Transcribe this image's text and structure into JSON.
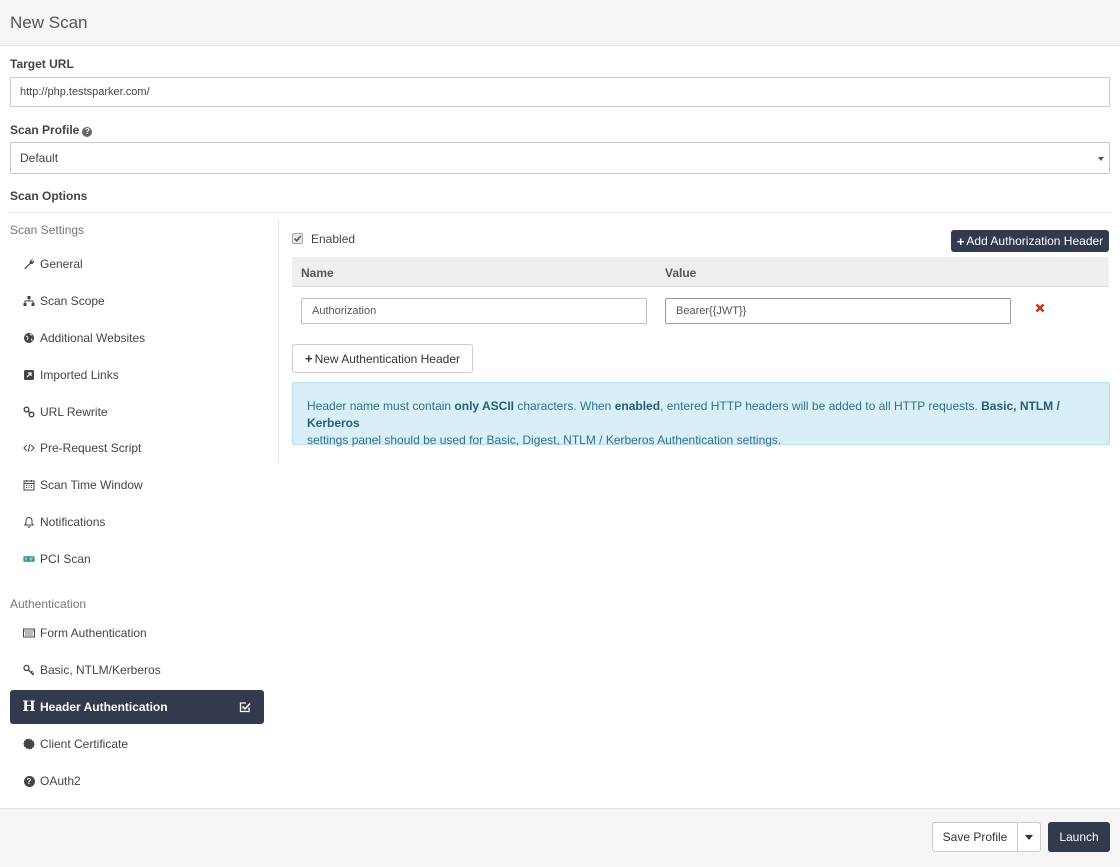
{
  "header": {
    "title": "New Scan"
  },
  "target_url": {
    "label": "Target URL",
    "value": "http://php.testsparker.com/"
  },
  "scan_profile": {
    "label": "Scan Profile",
    "help_icon": "question-circle-icon",
    "selected": "Default"
  },
  "scan_options": {
    "label": "Scan Options"
  },
  "sidebar": {
    "settings_heading": "Scan Settings",
    "settings_items": [
      {
        "label": "General",
        "icon": "wrench-icon"
      },
      {
        "label": "Scan Scope",
        "icon": "sitemap-icon"
      },
      {
        "label": "Additional Websites",
        "icon": "globe-icon"
      },
      {
        "label": "Imported Links",
        "icon": "external-link-icon"
      },
      {
        "label": "URL Rewrite",
        "icon": "link-icon"
      },
      {
        "label": "Pre-Request Script",
        "icon": "code-icon"
      },
      {
        "label": "Scan Time Window",
        "icon": "calendar-icon"
      },
      {
        "label": "Notifications",
        "icon": "bell-icon"
      },
      {
        "label": "PCI Scan",
        "icon": "pci-icon"
      }
    ],
    "auth_heading": "Authentication",
    "auth_items": [
      {
        "label": "Form Authentication",
        "icon": "form-icon"
      },
      {
        "label": "Basic, NTLM/Kerberos",
        "icon": "key-icon"
      },
      {
        "label": "Header Authentication",
        "icon": "header-icon",
        "active": true
      },
      {
        "label": "Client Certificate",
        "icon": "certificate-icon"
      },
      {
        "label": "OAuth2",
        "icon": "question-circle-icon"
      }
    ]
  },
  "panel": {
    "enabled_label": "Enabled",
    "enabled_checked": true,
    "add_header_button": "Add Authorization Header",
    "columns": {
      "name": "Name",
      "value": "Value"
    },
    "row": {
      "name": "Authorization",
      "value": "Bearer{{JWT}}"
    },
    "new_header_button": "New Authentication Header",
    "alert": {
      "t1": "Header name must contain ",
      "b1": "only ASCII",
      "t2": " characters. When ",
      "b2": "enabled",
      "t3": ", entered HTTP headers will be added to all HTTP requests. ",
      "b3": "Basic, NTLM / Kerberos",
      "t4": "settings panel should be used for Basic, Digest, NTLM / Kerberos Authentication settings."
    }
  },
  "footer": {
    "save_profile": "Save Profile",
    "launch": "Launch"
  },
  "colors": {
    "dark": "#333a4d",
    "alert_bg": "#d9eff7",
    "remove": "#d9261c"
  }
}
